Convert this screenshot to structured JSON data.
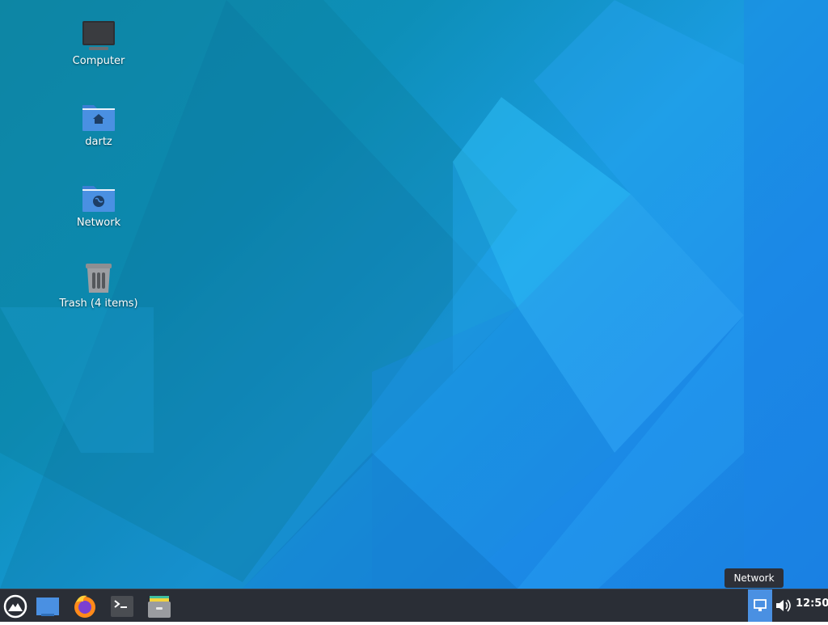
{
  "desktop": {
    "icons": [
      {
        "label": "Computer",
        "icon": "computer-icon"
      },
      {
        "label": "dartz",
        "icon": "home-folder-icon"
      },
      {
        "label": "Network",
        "icon": "network-folder-icon"
      },
      {
        "label": "Trash (4 items)",
        "icon": "trash-icon"
      }
    ]
  },
  "taskbar": {
    "launchers": [
      {
        "icon": "whisker-menu-icon"
      },
      {
        "icon": "show-desktop-icon"
      },
      {
        "icon": "firefox-icon"
      },
      {
        "icon": "terminal-icon"
      },
      {
        "icon": "file-manager-icon"
      }
    ],
    "tray": {
      "network_icon": "network-tray-icon",
      "volume_icon": "volume-icon",
      "clock": "12:50"
    },
    "tooltip": "Network"
  },
  "colors": {
    "accent": "#4a90e2",
    "taskbar_bg": "#2a2e36"
  }
}
